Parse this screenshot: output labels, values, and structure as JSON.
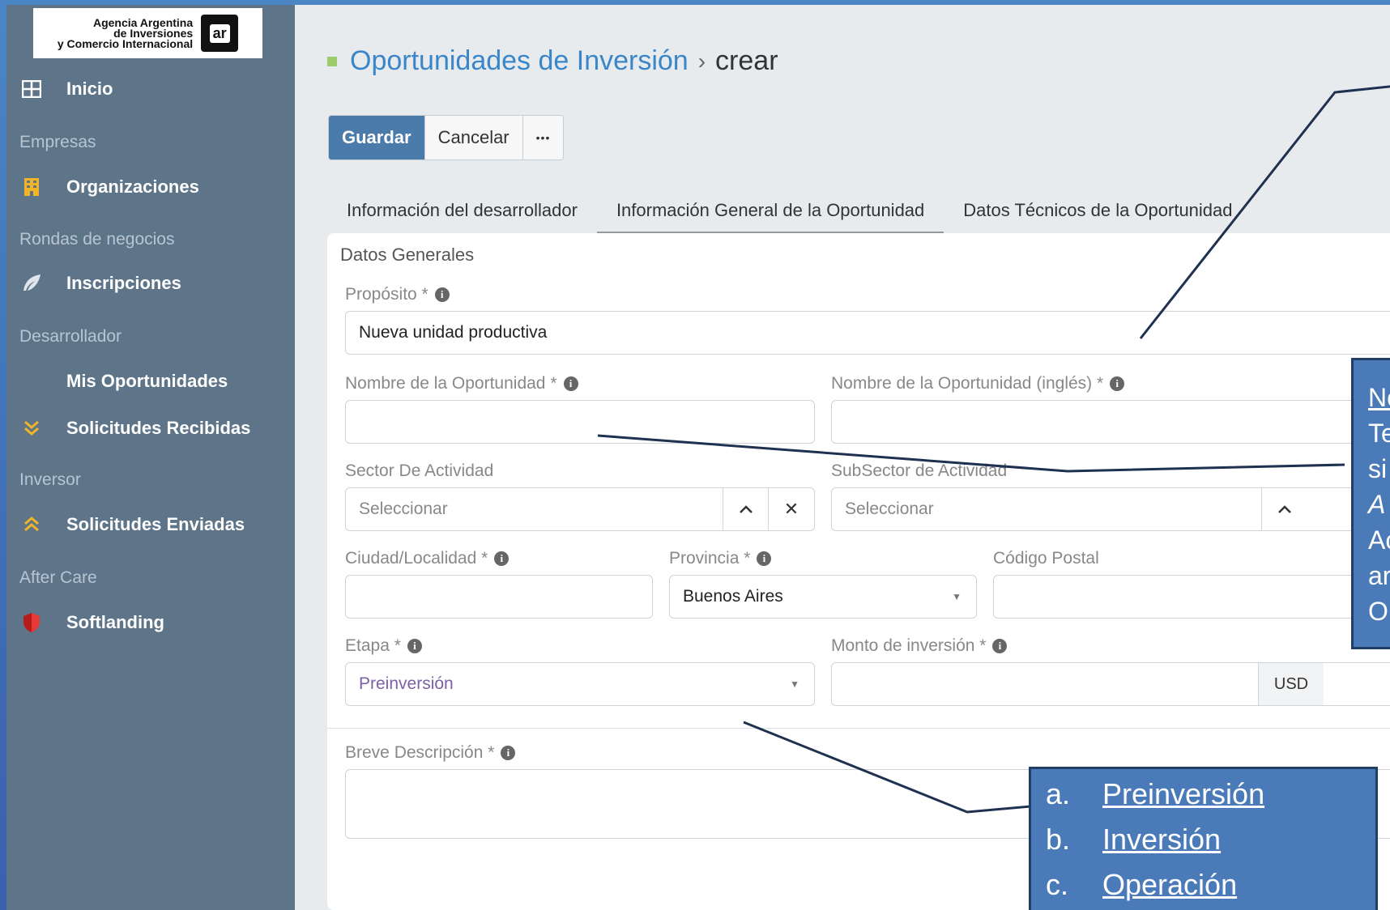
{
  "logo": {
    "line1": "Agencia Argentina",
    "line2": "de Inversiones",
    "line3": "y Comercio Internacional",
    "mark": "ar"
  },
  "sidebar": {
    "inicio": "Inicio",
    "sec_empresas": "Empresas",
    "organizaciones": "Organizaciones",
    "sec_rondas": "Rondas de negocios",
    "inscripciones": "Inscripciones",
    "sec_desarrollador": "Desarrollador",
    "mis_oportunidades": "Mis Oportunidades",
    "solicitudes_recibidas": "Solicitudes Recibidas",
    "sec_inversor": "Inversor",
    "solicitudes_enviadas": "Solicitudes Enviadas",
    "sec_aftercare": "After Care",
    "softlanding": "Softlanding"
  },
  "breadcrumb": {
    "link": "Oportunidades de Inversión",
    "separator": "›",
    "current": "crear"
  },
  "toolbar": {
    "save": "Guardar",
    "cancel": "Cancelar",
    "more": "•••"
  },
  "tabs": {
    "dev": "Información del desarrollador",
    "general": "Información General de la Oportunidad",
    "tech": "Datos Técnicos de la Oportunidad"
  },
  "form": {
    "section": "Datos Generales",
    "proposito_label": "Propósito *",
    "proposito_value": "Nueva unidad productiva",
    "nombre_label": "Nombre de la Oportunidad *",
    "nombre_en_label": "Nombre de la Oportunidad (inglés) *",
    "sector_label": "Sector De Actividad",
    "sector_placeholder": "Seleccionar",
    "subsector_label": "SubSector de Actividad",
    "subsector_placeholder": "Seleccionar",
    "ciudad_label": "Ciudad/Localidad *",
    "provincia_label": "Provincia *",
    "provincia_value": "Buenos Aires",
    "cp_label": "Código Postal",
    "etapa_label": "Etapa *",
    "etapa_value": "Preinversión",
    "monto_label": "Monto de inversión *",
    "monto_currency": "USD",
    "descripcion_label": "Breve Descripción *"
  },
  "annotations": {
    "stages": [
      {
        "key": "a.",
        "label": "Preinversión"
      },
      {
        "key": "b.",
        "label": "Inversión"
      },
      {
        "key": "c.",
        "label": "Operación"
      }
    ],
    "name_note": [
      "No",
      "Te",
      "si",
      "A",
      "Ac",
      "ar",
      "O"
    ]
  },
  "colors": {
    "sidebar_bg": "#5d7489",
    "primary": "#4a7bab",
    "link": "#3a86c8",
    "callout_bg": "#4a7bb8"
  }
}
